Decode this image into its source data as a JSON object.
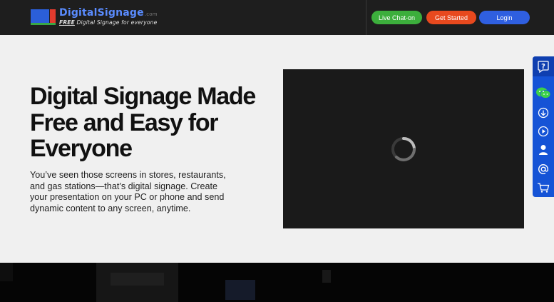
{
  "header": {
    "logo": {
      "title": "DigitalSignage",
      "suffix": ".com",
      "tagline_free": "FREE",
      "tagline_rest": " Digital Signage for everyone"
    },
    "buttons": {
      "chat": "Live Chat-on",
      "start": "Get Started",
      "login": "Login"
    }
  },
  "hero": {
    "title": "Digital Signage Made Free and Easy for Everyone",
    "description": "You’ve seen those screens in stores, restaurants, and gas stations—that’s digital signage. Create your presentation on your PC or phone and send dynamic content to any screen, anytime."
  },
  "sidebar": {
    "items": [
      "help-icon",
      "wechat-icon",
      "download-icon",
      "play-icon",
      "user-icon",
      "email-icon",
      "cart-icon"
    ]
  },
  "colors": {
    "header_bg": "#1e1e1e",
    "chat_green": "#3cae3c",
    "start_orange": "#e8491e",
    "login_blue": "#2f5fe0",
    "sidebar_blue": "#1553d6",
    "hero_bg": "#f0f0f0"
  }
}
